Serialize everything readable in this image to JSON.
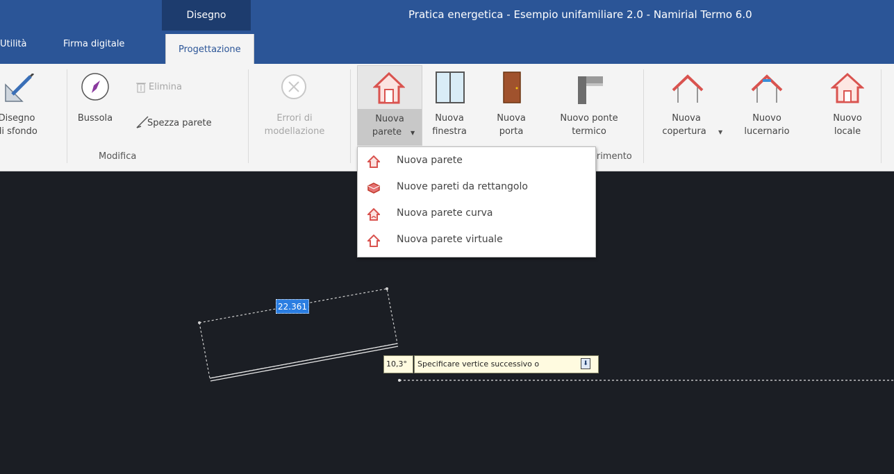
{
  "title_bar": {
    "context_tab": "Disegno",
    "app_title": "Pratica energetica - Esempio unifamiliare 2.0 - Namirial Termo 6.0"
  },
  "tabs": [
    "Utilità",
    "Firma digitale",
    "Progettazione"
  ],
  "ribbon": {
    "disegno_sfondo": [
      "Disegno",
      "di sfondo"
    ],
    "bussola": "Bussola",
    "elimina": "Elimina",
    "spezza_parete": "Spezza parete",
    "modifica_group": "Modifica",
    "errori": [
      "Errori di",
      "modellazione"
    ],
    "nuova_parete": [
      "Nuova",
      "parete"
    ],
    "nuova_finestra": [
      "Nuova",
      "finestra"
    ],
    "nuova_porta": [
      "Nuova",
      "porta"
    ],
    "nuovo_ponte": [
      "Nuovo ponte",
      "termico"
    ],
    "nuova_copertura": [
      "Nuova",
      "copertura"
    ],
    "nuovo_lucernario": [
      "Nuovo",
      "lucernario"
    ],
    "nuovo_locale": [
      "Nuovo",
      "locale"
    ],
    "inserimento_group": "Inserimento"
  },
  "dropdown": {
    "items": [
      {
        "label": "Nuova parete",
        "icon": "wall-icon"
      },
      {
        "label": "Nuove pareti da rettangolo",
        "icon": "rectangle-walls-icon"
      },
      {
        "label": "Nuova parete curva",
        "icon": "curved-wall-icon"
      },
      {
        "label": "Nuova parete virtuale",
        "icon": "virtual-wall-icon"
      }
    ]
  },
  "canvas": {
    "length_input": "22.361",
    "angle": "10,3°",
    "prompt": "Specificare vertice successivo o"
  },
  "colors": {
    "title_bar": "#2b5597",
    "context_tab": "#1d3c6e",
    "ribbon": "#f4f4f4",
    "canvas": "#1b1e24",
    "accent_red": "#d9534f"
  }
}
